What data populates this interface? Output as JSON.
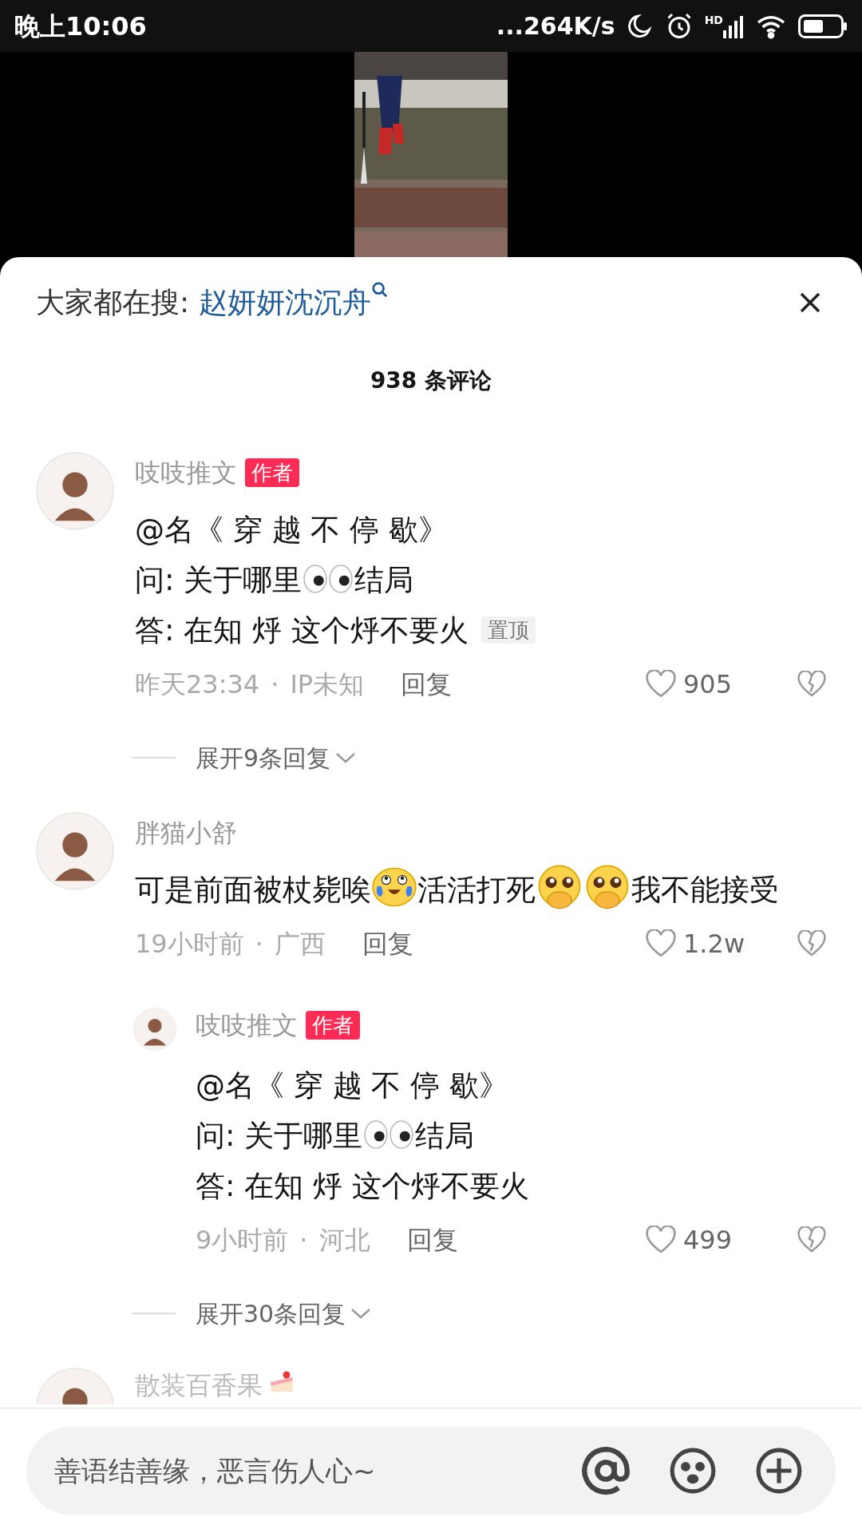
{
  "status_bar": {
    "time": "晚上10:06",
    "speed": "...264K/s",
    "network_label": "HD"
  },
  "search_hint": {
    "label": "大家都在搜:",
    "query": "赵妍妍沈沉舟"
  },
  "comment_count": "938 条评论",
  "comments": [
    {
      "kind": "full",
      "author": "吱吱推文",
      "author_badge": "作者",
      "pinned_label": "置顶",
      "body": [
        [
          {
            "kind": "text",
            "text": "@名《 穿 越  不 停 歇》"
          }
        ],
        [
          {
            "kind": "text",
            "text": "问: 关于哪里"
          },
          {
            "kind": "eyes"
          },
          {
            "kind": "text",
            "text": "结局"
          }
        ],
        [
          {
            "kind": "text",
            "text": "答: 在知 烀 这个烀不要火"
          }
        ]
      ],
      "time": "昨天23:34",
      "separator": "·",
      "location": "IP未知",
      "reply": "回复",
      "likes": "905",
      "liked": false,
      "expand": "展开9条回复"
    },
    {
      "kind": "full",
      "author": "胖猫小舒",
      "body": [
        [
          {
            "kind": "text",
            "text": "可是前面被杖毙唉"
          },
          {
            "kind": "crying"
          },
          {
            "kind": "text",
            "text": "活活打死"
          },
          {
            "kind": "pleading"
          },
          {
            "kind": "pleading"
          },
          {
            "kind": "text",
            "text": "我不能接受"
          }
        ]
      ],
      "time": "19小时前",
      "separator": "·",
      "location": "广西",
      "reply": "回复",
      "likes": "1.2w",
      "liked": false,
      "replies": [
        {
          "author": "吱吱推文",
          "author_badge": "作者",
          "body": [
            [
              {
                "kind": "text",
                "text": "@名《 穿 越  不 停 歇》"
              }
            ],
            [
              {
                "kind": "text",
                "text": "问: 关于哪里"
              },
              {
                "kind": "eyes"
              },
              {
                "kind": "text",
                "text": "结局"
              }
            ],
            [
              {
                "kind": "text",
                "text": "答: 在知 烀 这个烀不要火"
              }
            ]
          ],
          "time": "9小时前",
          "separator": "·",
          "location": "河北",
          "reply": "回复",
          "likes": "499",
          "liked": false
        }
      ],
      "expand": "展开30条回复"
    },
    {
      "kind": "cut",
      "author": "散装百香果"
    }
  ],
  "input": {
    "placeholder": "善语结善缘，恶言伤人心~"
  }
}
